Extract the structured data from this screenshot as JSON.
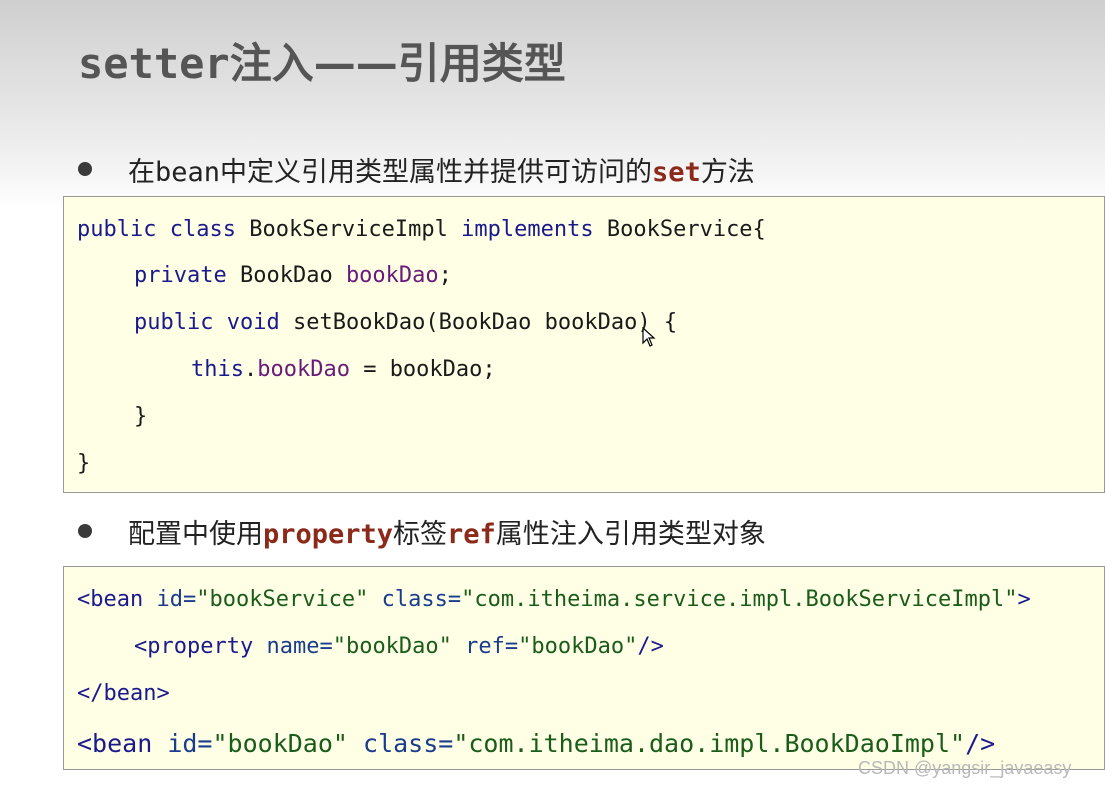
{
  "title": {
    "latin": "setter",
    "cjk": "注入——引用类型"
  },
  "bullet1": {
    "pre": "在",
    "bean": "bean",
    "mid": "中定义引用类型属性并提供可访问的",
    "kw": "set",
    "post": "方法"
  },
  "code1": {
    "l1_public": "public",
    "l1_class": "class",
    "l1_name": "BookServiceImpl",
    "l1_implements": "implements",
    "l1_iface": "BookService{",
    "l2_private": "private",
    "l2_type": "BookDao",
    "l2_field": "bookDao",
    "l2_semi": ";",
    "l3_public": "public",
    "l3_void": "void",
    "l3_rest": "setBookDao(BookDao bookDao) {",
    "l4_this": "this",
    "l4_dot": ".",
    "l4_field": "bookDao",
    "l4_rest": " = bookDao;",
    "l5": "}",
    "l6": "}"
  },
  "bullet2": {
    "pre": "配置中使用",
    "kw1": "property",
    "mid": "标签",
    "kw2": "ref",
    "post": "属性注入引用类型对象"
  },
  "code2": {
    "l1_open": "<bean",
    "l1_id_attr": "id=",
    "l1_id_val": "\"bookService\"",
    "l1_class_attr": "class=",
    "l1_class_val": "\"com.itheima.service.impl.BookServiceImpl\"",
    "l1_close": ">",
    "l2_open": "<property",
    "l2_name_attr": "name=",
    "l2_name_val": "\"bookDao\"",
    "l2_ref_attr": "ref=",
    "l2_ref_val": "\"bookDao\"",
    "l2_close": "/>",
    "l3": "</bean>",
    "l4_open": "<bean",
    "l4_id_attr": "id=",
    "l4_id_val": "\"bookDao\"",
    "l4_class_attr": "class=",
    "l4_class_val": "\"com.itheima.dao.impl.BookDaoImpl\"",
    "l4_close": "/>"
  },
  "watermark": "CSDN @yangsir_javaeasy",
  "colors": {
    "keyword": "#1a1a8c",
    "field": "#6a1a7a",
    "string": "#1a5c1a",
    "highlight": "#8b2a1a",
    "code_bg": "#ffffe6"
  }
}
